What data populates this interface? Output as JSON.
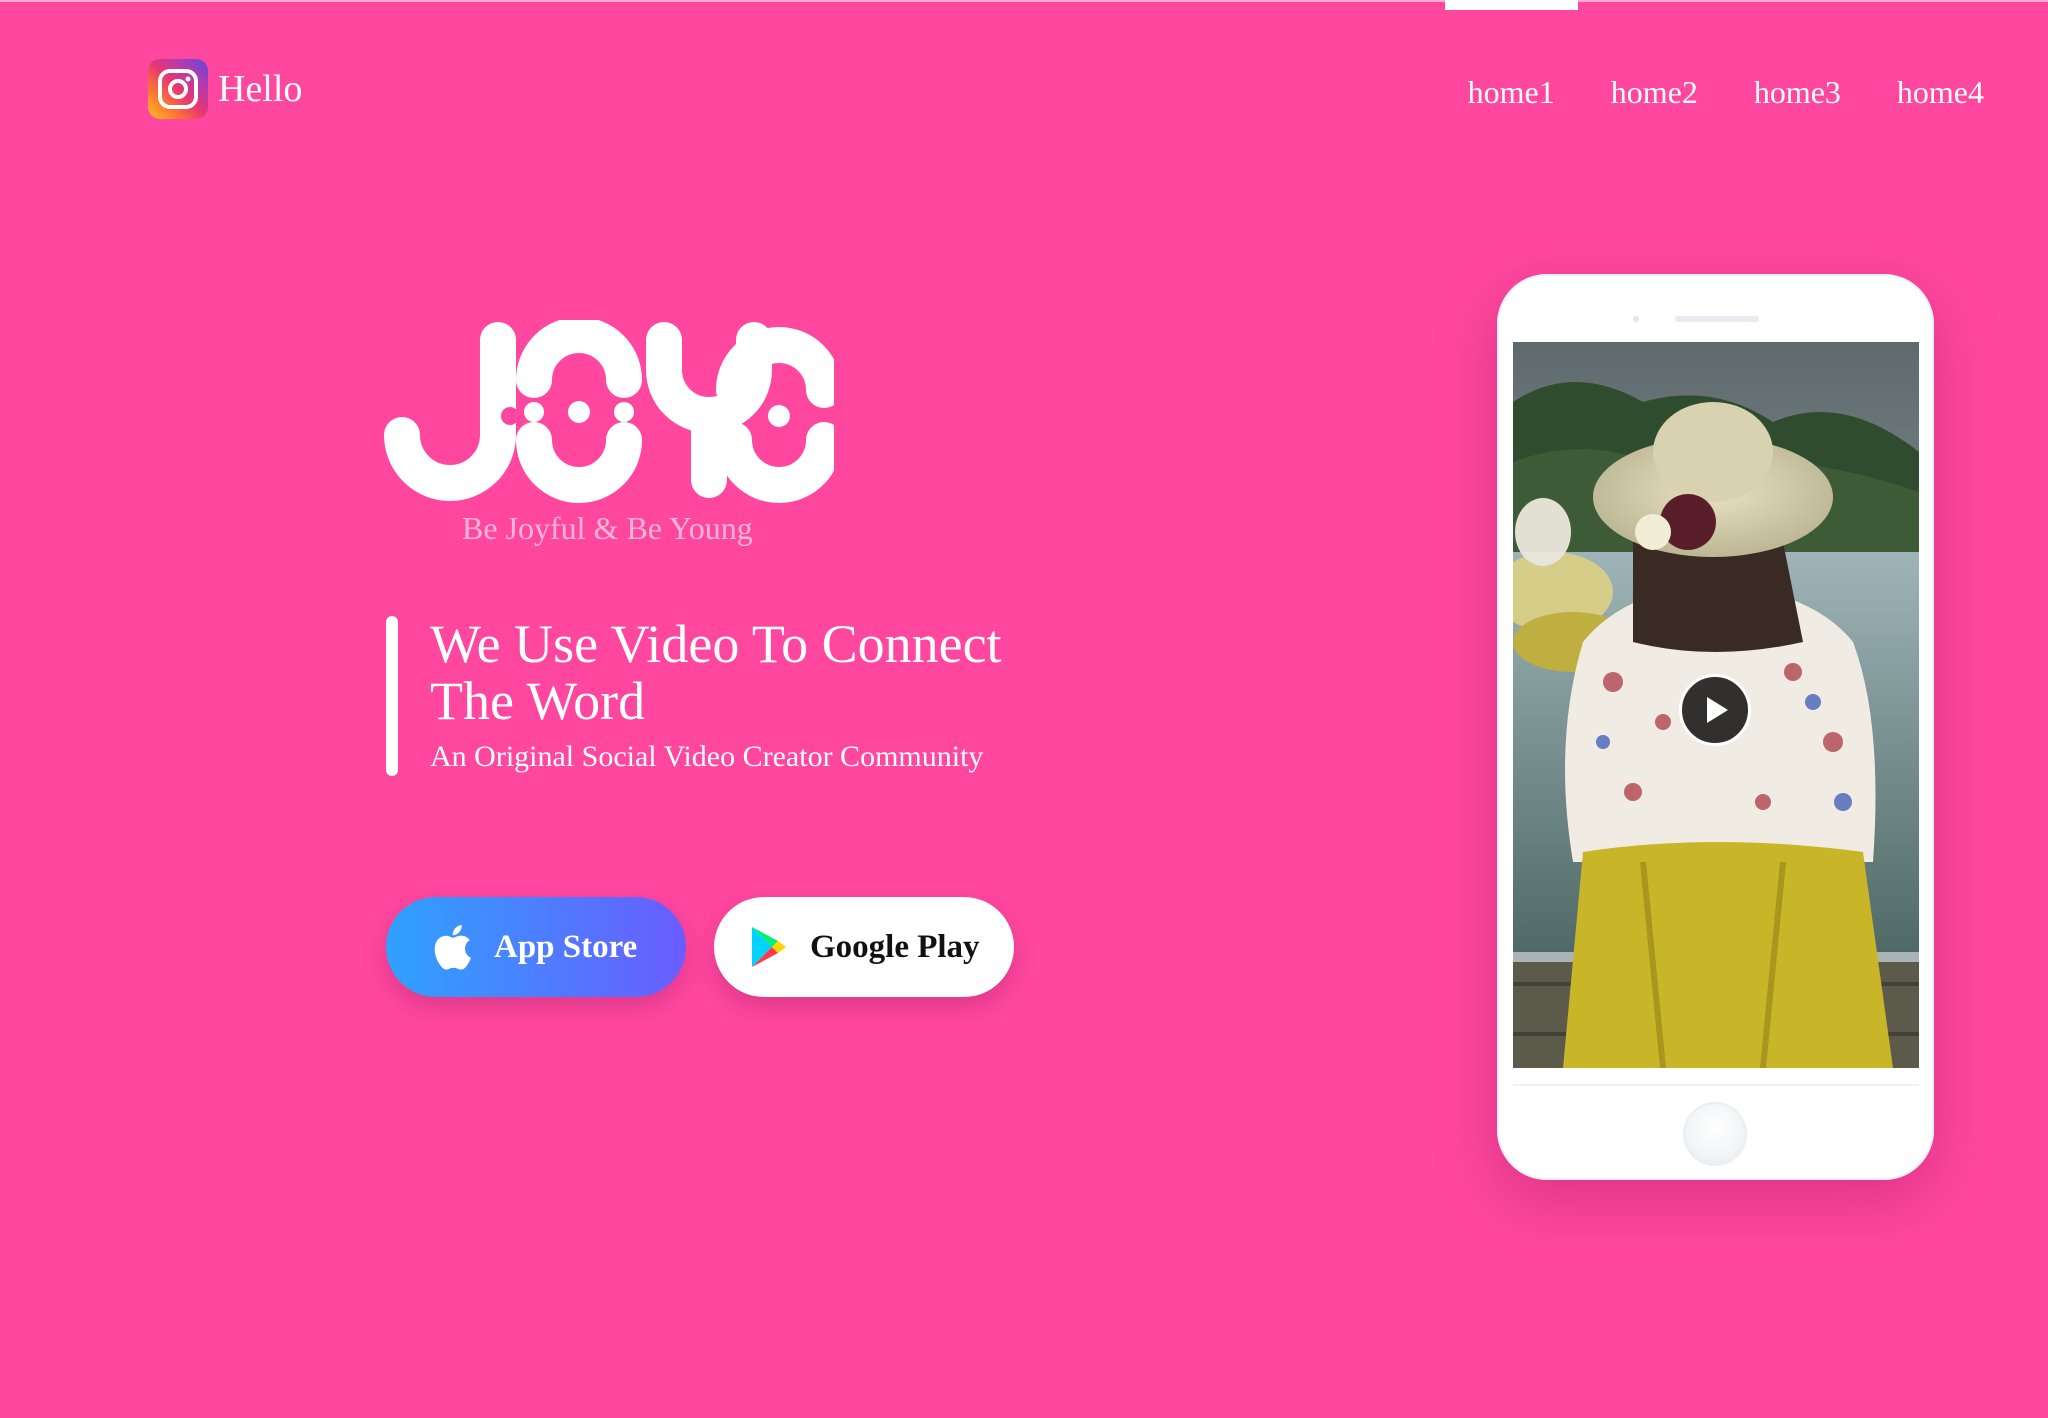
{
  "header": {
    "brand_name": "Hello",
    "brand_icon": "instagram-icon",
    "nav": [
      {
        "label": "home1"
      },
      {
        "label": "home2"
      },
      {
        "label": "home3"
      },
      {
        "label": "home4"
      }
    ]
  },
  "hero": {
    "logo_text": "JOYO",
    "tagline": "Be Joyful & Be Young",
    "headline": "We Use Video To Connect The Word",
    "subheadline": "An Original Social Video Creator Community",
    "buttons": {
      "app_store_label": "App Store",
      "app_store_icon": "apple-icon",
      "google_play_label": "Google Play",
      "google_play_icon": "google-play-icon"
    }
  },
  "phone": {
    "screen_image": "woman-in-hat-by-lake-photo",
    "play_icon": "play-icon"
  },
  "colors": {
    "background": "#ff479f",
    "app_store_gradient_start": "#2ea2ff",
    "app_store_gradient_end": "#6a5cff",
    "tagline": "#ffb6d6"
  }
}
